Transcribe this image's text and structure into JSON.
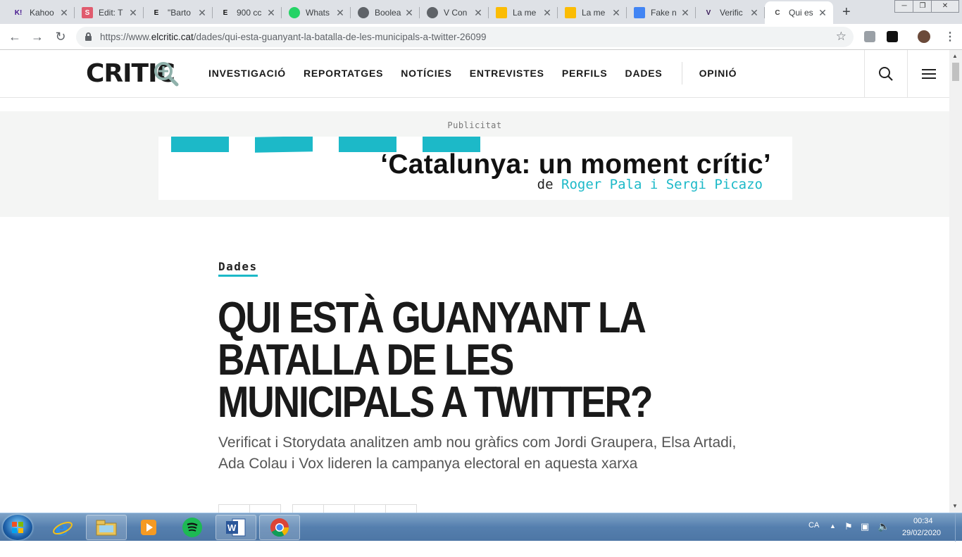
{
  "browser": {
    "tabs": [
      {
        "title": "Kahoo",
        "favicon": "kahoot-icon",
        "favicon_text": "K!",
        "favicon_color": "#46178f",
        "favicon_bg": "#dee1e6"
      },
      {
        "title": "Edit: T",
        "favicon": "s-icon",
        "favicon_text": "S",
        "favicon_color": "#ffffff",
        "favicon_bg": "#e05b6e"
      },
      {
        "title": "\"Barto",
        "favicon": "e-icon",
        "favicon_text": "E",
        "favicon_color": "#111111",
        "favicon_bg": "#dee1e6"
      },
      {
        "title": "900 cc",
        "favicon": "e-icon",
        "favicon_text": "E",
        "favicon_color": "#111111",
        "favicon_bg": "#dee1e6"
      },
      {
        "title": "Whats",
        "favicon": "whatsapp-icon",
        "favicon_text": "",
        "favicon_color": "#25d366",
        "favicon_bg": "#25d366"
      },
      {
        "title": "Boolea",
        "favicon": "globe-icon",
        "favicon_text": "",
        "favicon_color": "#5f6368",
        "favicon_bg": "#5f6368"
      },
      {
        "title": "V Con",
        "favicon": "globe-icon",
        "favicon_text": "",
        "favicon_color": "#5f6368",
        "favicon_bg": "#5f6368"
      },
      {
        "title": "La me",
        "favicon": "drive-icon",
        "favicon_text": "",
        "favicon_color": "#0f9d58",
        "favicon_bg": "#fbbc04"
      },
      {
        "title": "La me",
        "favicon": "drive-icon",
        "favicon_text": "",
        "favicon_color": "#0f9d58",
        "favicon_bg": "#fbbc04"
      },
      {
        "title": "Fake n",
        "favicon": "docs-icon",
        "favicon_text": "",
        "favicon_color": "#4285f4",
        "favicon_bg": "#4285f4"
      },
      {
        "title": "Verific",
        "favicon": "verificat-icon",
        "favicon_text": "V",
        "favicon_color": "#3b1c5a",
        "favicon_bg": "#dee1e6"
      },
      {
        "title": "Qui es",
        "favicon": "critic-icon",
        "favicon_text": "C",
        "favicon_color": "#444444",
        "favicon_bg": "#ffffff",
        "active": true
      }
    ],
    "new_tab_label": "+",
    "url_prefix": "https://www.",
    "url_host": "elcritic.cat",
    "url_path": "/dades/qui-esta-guanyant-la-batalla-de-les-municipals-a-twitter-26099"
  },
  "site": {
    "logo_text": "CRITIC",
    "nav": [
      "INVESTIGACIÓ",
      "REPORTATGES",
      "NOTÍCIES",
      "ENTREVISTES",
      "PERFILS",
      "DADES"
    ],
    "nav_opinion": "OPINIÓ",
    "accent": "#1cb9c8"
  },
  "ad": {
    "label": "Publicitat",
    "title": "‘Catalunya: un moment crític’",
    "by": "de",
    "authors": "Roger Pala i Sergi Picazo"
  },
  "article": {
    "category": "Dades",
    "headline": "QUI ESTÀ GUANYANT LA BATALLA DE LES MUNICIPALS A TWITTER?",
    "subtitle": "Verificat i Storydata analitzen amb nou gràfics com Jordi Graupera, Elsa Artadi, Ada Colau i Vox lideren la campanya electoral en aquesta xarxa"
  },
  "taskbar": {
    "apps": [
      "file-explorer-icon",
      "internet-explorer-icon",
      "media-player-icon",
      "spotify-icon",
      "word-icon",
      "chrome-icon"
    ],
    "language": "CA",
    "time": "00:34",
    "date": "29/02/2020"
  }
}
